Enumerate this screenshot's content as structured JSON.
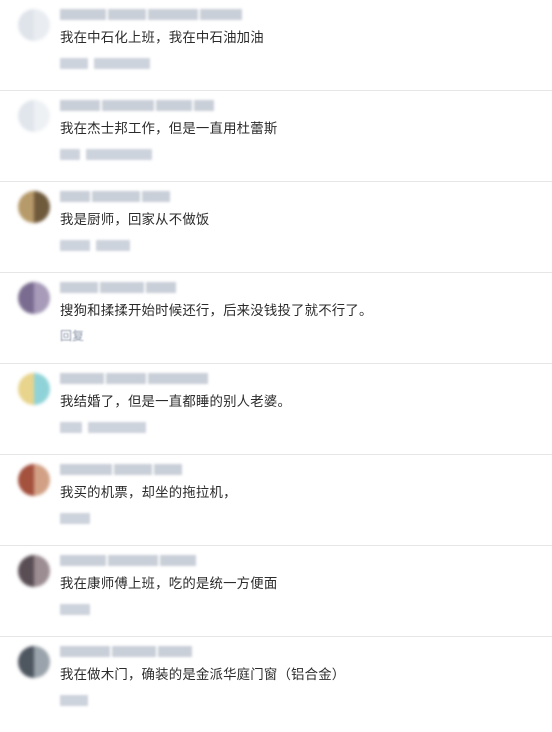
{
  "comments": [
    {
      "text": "我在中石化上班，我在中石油加油",
      "avatar_colors": [
        "#dfe4ea",
        "#e9edf1"
      ]
    },
    {
      "text": "我在杰士邦工作，但是一直用杜蕾斯",
      "avatar_colors": [
        "#e1e6ec",
        "#eef1f4"
      ]
    },
    {
      "text": "我是厨师，回家从不做饭",
      "avatar_colors": [
        "#b79a6a",
        "#6f5a3c"
      ]
    },
    {
      "text": "搜狗和揉揉开始时候还行，后来没钱投了就不行了。",
      "reply_label": "回复",
      "avatar_colors": [
        "#7a6c90",
        "#a79bb9"
      ]
    },
    {
      "text": "我结婚了，但是一直都睡的别人老婆。",
      "avatar_colors": [
        "#e8d48c",
        "#8fd3d8"
      ]
    },
    {
      "text": "我买的机票，却坐的拖拉机，",
      "avatar_colors": [
        "#a4513e",
        "#d2a185"
      ]
    },
    {
      "text": "我在康师傅上班，吃的是统一方便面",
      "avatar_colors": [
        "#5a4e55",
        "#9c8d92"
      ]
    },
    {
      "text": "我在做木门，确装的是金派华庭门窗（铝合金）",
      "avatar_colors": [
        "#4e5660",
        "#9aa3ab"
      ]
    }
  ]
}
